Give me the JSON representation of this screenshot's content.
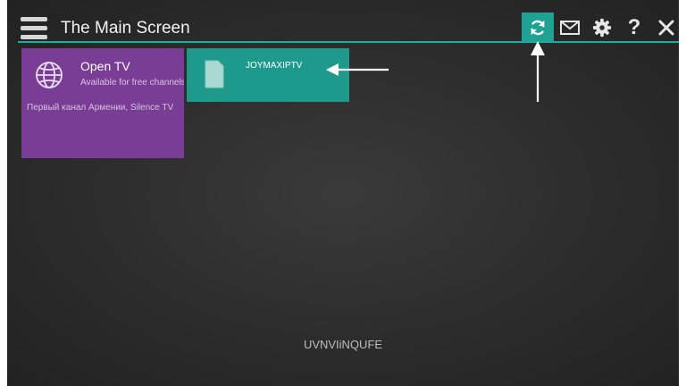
{
  "header": {
    "title": "The Main Screen",
    "icons": [
      "menu-icon",
      "refresh-icon",
      "mail-icon",
      "gear-icon",
      "help-icon",
      "close-icon"
    ],
    "help_label": "?"
  },
  "tiles": [
    {
      "name": "Open TV",
      "subtitle": "Available for free channels",
      "description": "Первый канал Армении, Silence TV",
      "icon": "globe-icon",
      "color": "#7a3d96"
    },
    {
      "name": "JOYMAXIPTV",
      "icon": "file-icon",
      "color": "#1e9a8c"
    }
  ],
  "footer": {
    "code": "UVNVIiNQUFE"
  },
  "colors": {
    "accent": "#1fa193",
    "background": "#2c2c2c",
    "annotation": "#ffffff"
  }
}
